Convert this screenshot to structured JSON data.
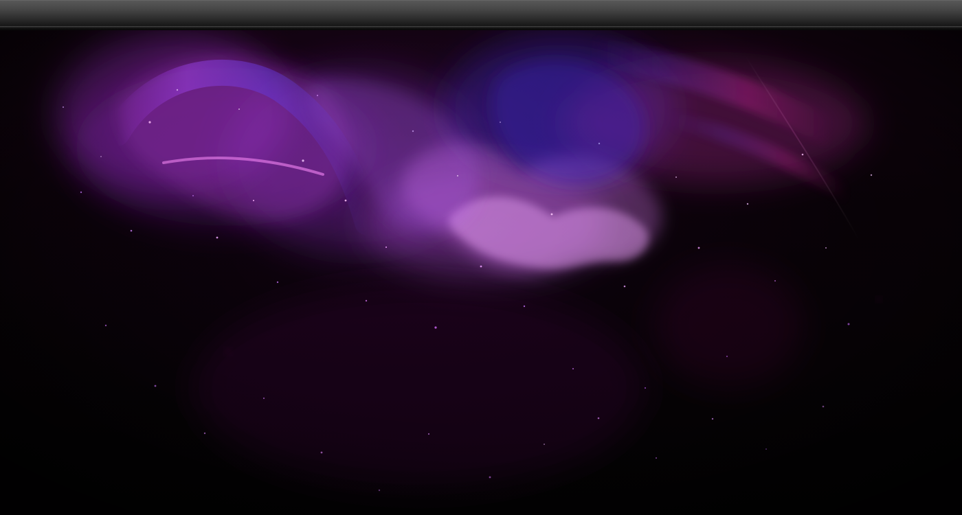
{
  "scene": {
    "primary_color": "#a44ed8",
    "secondary_color": "#5d40d8",
    "accent_color": "#c32689",
    "background_color": "#050205",
    "decorative_elements": [
      "nebula",
      "starfield",
      "light-streaks"
    ]
  }
}
